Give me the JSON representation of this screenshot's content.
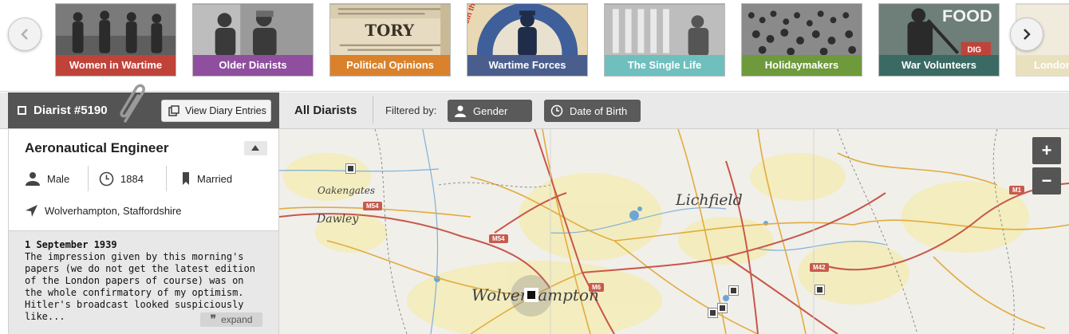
{
  "carousel": {
    "prev_label": "previous",
    "next_label": "next",
    "topics": [
      {
        "label": "Women in Wartime",
        "color": "#c0433a"
      },
      {
        "label": "Older Diarists",
        "color": "#8f4f9e"
      },
      {
        "label": "Political Opinions",
        "color": "#d9822b"
      },
      {
        "label": "Wartime Forces",
        "color": "#4a5e8e"
      },
      {
        "label": "The Single Life",
        "color": "#6fbfbf"
      },
      {
        "label": "Holidaymakers",
        "color": "#6e9a3c"
      },
      {
        "label": "War Volunteers",
        "color": "#3a6a63"
      },
      {
        "label": "London",
        "color": "#d8c98a"
      }
    ]
  },
  "thumb_text": {
    "tory": "TORY",
    "forces": "Join the R.A.F.",
    "food": "FOOD",
    "dig": "DIG"
  },
  "diarist": {
    "title": "Diarist #5190",
    "view_button": "View Diary Entries",
    "occupation": "Aeronautical Engineer",
    "gender": "Male",
    "birth_year": "1884",
    "marital_status": "Married",
    "location": "Wolverhampton, Staffordshire",
    "entry_date": "1 September 1939",
    "entry_excerpt": "The impression given by this morning's papers (we do not get the latest edition of the London papers of course) was on the whole confirmatory of my optimism. Hitler's broadcast looked suspiciously like...",
    "expand_label": "expand"
  },
  "filters": {
    "all_label": "All Diarists",
    "filtered_by": "Filtered by:",
    "chips": [
      "Gender",
      "Date of Birth"
    ]
  },
  "map": {
    "places": [
      "Oakengates",
      "Dawley",
      "Lichfield",
      "Wolverhampton"
    ],
    "roads": [
      "M54",
      "M54",
      "M6",
      "M42",
      "M1"
    ],
    "zoom_in": "+",
    "zoom_out": "−"
  }
}
